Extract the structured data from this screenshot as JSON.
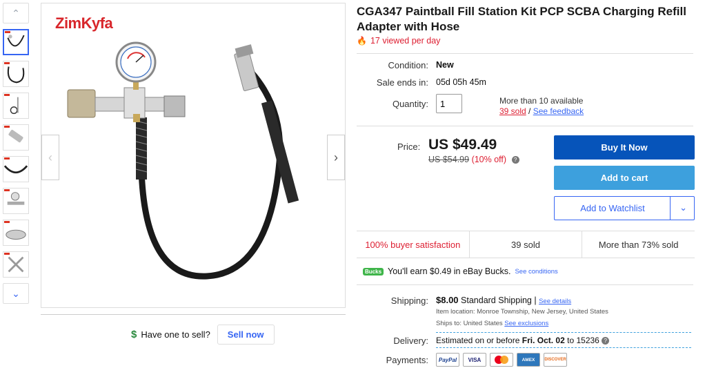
{
  "title": "CGA347 Paintball Fill Station Kit PCP SCBA Charging Refill Adapter with Hose",
  "viewed": "17 viewed per day",
  "brand_logo": "ZimKyfa",
  "condition": {
    "label": "Condition:",
    "value": "New"
  },
  "sale_ends": {
    "label": "Sale ends in:",
    "value": "05d 05h 45m"
  },
  "quantity": {
    "label": "Quantity:",
    "value": "1",
    "available": "More than 10 available",
    "sold_link": "39 sold",
    "separator": "/",
    "feedback_link": "See feedback"
  },
  "price": {
    "label": "Price:",
    "value": "US $49.49",
    "original": "US $54.99",
    "discount": "(10% off)"
  },
  "buttons": {
    "buy_now": "Buy It Now",
    "add_to_cart": "Add to cart",
    "add_to_watchlist": "Add to Watchlist"
  },
  "stats": [
    "100% buyer satisfaction",
    "39 sold",
    "More than 73% sold"
  ],
  "bucks": {
    "badge": "Bucks",
    "text": "You'll earn $0.49 in eBay Bucks.",
    "link": "See conditions"
  },
  "shipping": {
    "label": "Shipping:",
    "amount": "$8.00",
    "method": "Standard Shipping |",
    "details_link": "See details",
    "item_location_label": "Item location:",
    "item_location": "Monroe Township, New Jersey, United States",
    "ships_to_label": "Ships to:",
    "ships_to": "United States",
    "exclusions_link": "See exclusions"
  },
  "delivery": {
    "label": "Delivery:",
    "prefix": "Estimated on or before",
    "date": "Fri. Oct. 02",
    "suffix": "to 15236"
  },
  "payments": {
    "label": "Payments:",
    "methods": [
      "PayPal",
      "VISA",
      "MasterCard",
      "AMEX",
      "DISCOVER"
    ]
  },
  "sell": {
    "question": "Have one to sell?",
    "button": "Sell now",
    "icon": "$"
  },
  "colors": {
    "accent": "#3665f3",
    "buy": "#0654ba",
    "cart": "#3da0dd",
    "alert": "#dd1e31"
  }
}
